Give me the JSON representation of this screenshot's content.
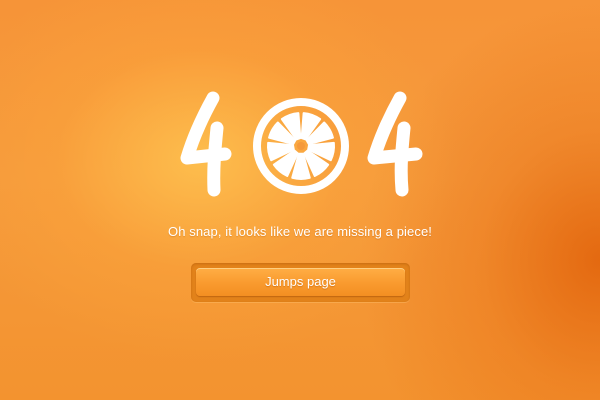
{
  "hero": {
    "digit_left": "4",
    "digit_right": "4",
    "zero_icon": "orange-slice-icon"
  },
  "message": "Oh snap, it looks like we are missing a piece!",
  "button": {
    "label": "Jumps page"
  },
  "colors": {
    "background": "#f59a3c",
    "accent": "#ffae45",
    "text": "#ffffff"
  }
}
